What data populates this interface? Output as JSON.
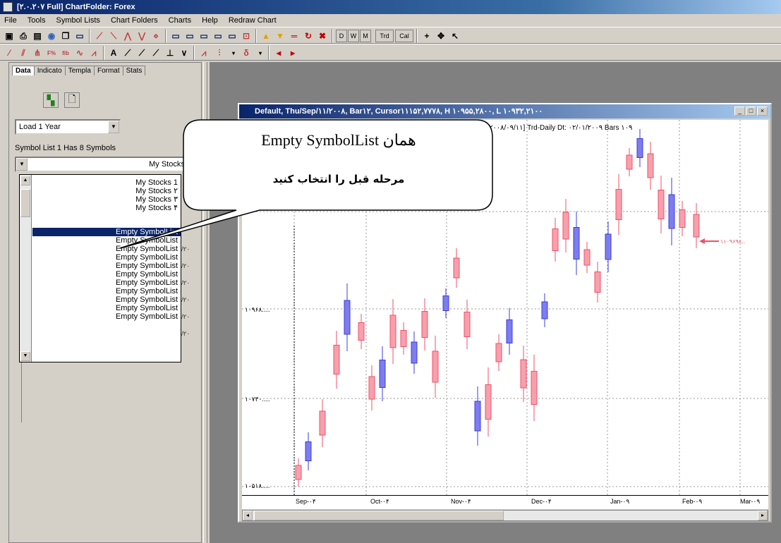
{
  "window": {
    "title": "[۲.۰.۲۰۷ Full] ChartFolder: Forex"
  },
  "menu": [
    "File",
    "Tools",
    "Symbol Lists",
    "Chart Folders",
    "Charts",
    "Help",
    "Redraw Chart"
  ],
  "toolbar": {
    "period_buttons": [
      "D",
      "W",
      "M"
    ],
    "trd_label": "Trd",
    "cal_label": "Cal",
    "text_tool": "A"
  },
  "left_panel": {
    "tabs": [
      "Data",
      "Indicato",
      "Templa",
      "Format",
      "Stats"
    ],
    "load_combo": "Load 1 Year",
    "symbol_list_info": "Symbol List 1 Has 8 Symbols",
    "symbol_list_combo": "My Stocks 1",
    "dropdown_items": [
      "My Stocks 1",
      "My Stocks ۲",
      "My Stocks ۳",
      "My Stocks ۴",
      "Empty SymbolList",
      "Empty SymbolList",
      "Empty SymbolList",
      "Empty SymbolList",
      "Empty SymbolList",
      "Empty SymbolList",
      "Empty SymbolList",
      "Empty SymbolList",
      "Empty SymbolList",
      "Empty SymbolList",
      "Empty SymbolList"
    ],
    "cut_cells": [
      "/۲۰",
      "/۲۰",
      "/۲۰",
      "/۲۰",
      "/۲۰",
      "/۲۰",
      "/۲۰"
    ]
  },
  "chart_window": {
    "title": "Default, Thu/Sep/۱۱/۲۰۰۸, Bar۱۲, Cursor۱۱۱۵۲,۷۷۷۸, H ۱۰۹۵۵,۲۸۰۰, L ۱۰۹۳۲,۲۱۰۰",
    "info_line": "۲۰۰۸/۰۹/۱۱] Trd-Daily Dt: ۰۲/۰۱/۲۰۰۹ Bars ۱۰۹",
    "price_labels": [
      "۱۰۹۶۸....",
      "۱۰۷۳۰....",
      "۱۰۵۱۸...."
    ],
    "last_price_label": "۱۱۰۹۶۹۸..",
    "x_labels": [
      "Sep-۰۴",
      "Oct-۰۴",
      "Nov-۰۴",
      "Dec-۰۴",
      "Jan-۰۹",
      "Feb-۰۹",
      "Mar-۰۹"
    ]
  },
  "callout": {
    "line1": "همان Empty SymbolList",
    "line2": "مرحله قبل را انتخاب کنید"
  },
  "colors": {
    "bull": "#f0506a",
    "bear": "#3c3cdc",
    "selection": "#0a246a"
  }
}
